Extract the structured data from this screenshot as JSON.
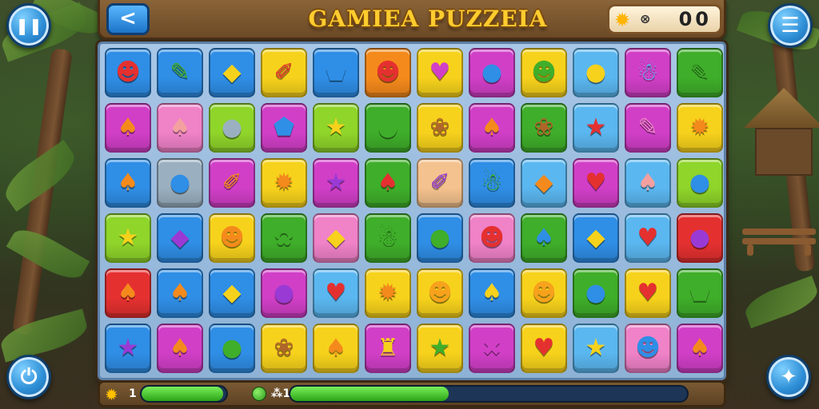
{
  "header": {
    "back_icon": "arrow-left-icon",
    "back_glyph": "<",
    "title": "GAMIEA PUZZEIA",
    "score_icon": "star-icon",
    "score_symbol": "⊗",
    "score_value": "00"
  },
  "side_buttons": {
    "pause_glyph": "❚❚",
    "menu_glyph": "☰",
    "restart_glyph": "⏻",
    "hint_glyph": "✦"
  },
  "footer": {
    "level_star_icon": "star-icon",
    "level_value": "1",
    "progress_1_fraction": 0.96,
    "dot_icon": "green-orb-icon",
    "progress_2_label": "⁂1",
    "progress_2_fraction": 0.4
  },
  "colors": {
    "red": "#e53030",
    "orange": "#f58a1c",
    "yellow": "#f7d21c",
    "green": "#3fae2a",
    "lime": "#8fd52a",
    "blue": "#2f8ee6",
    "lightblue": "#5bb7f0",
    "purple": "#9a3ad4",
    "magenta": "#d13fc7",
    "pink": "#f082c8",
    "peach": "#f4c28e",
    "gray": "#9ab0c0"
  },
  "board": {
    "rows": [
      [
        {
          "bg": "blue",
          "fg": "#e53030",
          "glyph": "☻",
          "name": "red-blob-icon"
        },
        {
          "bg": "blue",
          "fg": "#3fae2a",
          "glyph": "✎",
          "name": "green-bottle-icon"
        },
        {
          "bg": "blue",
          "fg": "#f7d21c",
          "glyph": "◆",
          "name": "yellow-gem-icon"
        },
        {
          "bg": "yellow",
          "fg": "#e53030",
          "glyph": "✐",
          "name": "red-rocket-icon"
        },
        {
          "bg": "blue",
          "fg": "#2f8ee6",
          "glyph": "⬟",
          "name": "blue-shield-icon"
        },
        {
          "bg": "orange",
          "fg": "#e53030",
          "glyph": "☻",
          "name": "red-face-icon"
        },
        {
          "bg": "yellow",
          "fg": "#d13fc7",
          "glyph": "♥",
          "name": "purple-heart-icon"
        },
        {
          "bg": "magenta",
          "fg": "#2f8ee6",
          "glyph": "●",
          "name": "blue-orb-icon"
        },
        {
          "bg": "yellow",
          "fg": "#3fae2a",
          "glyph": "☻",
          "name": "green-face-icon"
        },
        {
          "bg": "lightblue",
          "fg": "#f7d21c",
          "glyph": "●",
          "name": "yellow-drop-icon"
        },
        {
          "bg": "magenta",
          "fg": "#5bb7f0",
          "glyph": "☃",
          "name": "blue-creature-icon"
        },
        {
          "bg": "green",
          "fg": "#3fae2a",
          "glyph": "✎",
          "name": "green-rocket-icon"
        }
      ],
      [
        {
          "bg": "magenta",
          "fg": "#f58a1c",
          "glyph": "♠",
          "name": "orange-carrot-icon"
        },
        {
          "bg": "pink",
          "fg": "#f4a0a0",
          "glyph": "♠",
          "name": "pink-drop-icon"
        },
        {
          "bg": "lime",
          "fg": "#9ab0c0",
          "glyph": "●",
          "name": "gray-blob-icon"
        },
        {
          "bg": "magenta",
          "fg": "#2f8ee6",
          "glyph": "⬟",
          "name": "blue-gem-icon"
        },
        {
          "bg": "lime",
          "fg": "#f7d21c",
          "glyph": "★",
          "name": "yellow-star-icon"
        },
        {
          "bg": "green",
          "fg": "#3fae2a",
          "glyph": "●",
          "name": "green-balloon-icon"
        },
        {
          "bg": "yellow",
          "fg": "#b0652a",
          "glyph": "❀",
          "name": "bread-icon"
        },
        {
          "bg": "magenta",
          "fg": "#f58a1c",
          "glyph": "♠",
          "name": "orange-carrot-icon"
        },
        {
          "bg": "green",
          "fg": "#b0652a",
          "glyph": "❀",
          "name": "bread-loaf-icon"
        },
        {
          "bg": "lightblue",
          "fg": "#e53030",
          "glyph": "★",
          "name": "red-star-icon"
        },
        {
          "bg": "magenta",
          "fg": "#f082c8",
          "glyph": "✎",
          "name": "pink-rocket-icon"
        },
        {
          "bg": "yellow",
          "fg": "#f58a1c",
          "glyph": "✹",
          "name": "orange-sun-icon"
        }
      ],
      [
        {
          "bg": "blue",
          "fg": "#f58a1c",
          "glyph": "♠",
          "name": "orange-leaf-icon"
        },
        {
          "bg": "gray",
          "fg": "#2f8ee6",
          "glyph": "●",
          "name": "blue-balloon-icon"
        },
        {
          "bg": "magenta",
          "fg": "#f58a1c",
          "glyph": "✐",
          "name": "orange-pencil-icon"
        },
        {
          "bg": "yellow",
          "fg": "#f58a1c",
          "glyph": "✹",
          "name": "orange-sun-icon"
        },
        {
          "bg": "magenta",
          "fg": "#9a3ad4",
          "glyph": "★",
          "name": "purple-star-icon"
        },
        {
          "bg": "green",
          "fg": "#e53030",
          "glyph": "♠",
          "name": "red-pepper-icon"
        },
        {
          "bg": "peach",
          "fg": "#9a3ad4",
          "glyph": "✐",
          "name": "purple-rocket-icon"
        },
        {
          "bg": "blue",
          "fg": "#3fae2a",
          "glyph": "☃",
          "name": "green-frog-icon"
        },
        {
          "bg": "lightblue",
          "fg": "#f58a1c",
          "glyph": "◆",
          "name": "orange-gem-icon"
        },
        {
          "bg": "magenta",
          "fg": "#e53030",
          "glyph": "♥",
          "name": "red-heart-icon"
        },
        {
          "bg": "lightblue",
          "fg": "#f4a0a0",
          "glyph": "♠",
          "name": "pink-drop-icon"
        },
        {
          "bg": "lime",
          "fg": "#2f8ee6",
          "glyph": "●",
          "name": "blue-balloon-icon"
        }
      ],
      [
        {
          "bg": "lime",
          "fg": "#f7d21c",
          "glyph": "★",
          "name": "yellow-star-icon"
        },
        {
          "bg": "blue",
          "fg": "#9a3ad4",
          "glyph": "◆",
          "name": "purple-gem-icon"
        },
        {
          "bg": "yellow",
          "fg": "#f58a1c",
          "glyph": "☻",
          "name": "orange-face-icon"
        },
        {
          "bg": "green",
          "fg": "#3fae2a",
          "glyph": "✿",
          "name": "green-clover-icon"
        },
        {
          "bg": "pink",
          "fg": "#f7d21c",
          "glyph": "◆",
          "name": "yellow-candy-icon"
        },
        {
          "bg": "green",
          "fg": "#3fae2a",
          "glyph": "☃",
          "name": "green-frog-icon"
        },
        {
          "bg": "blue",
          "fg": "#3fae2a",
          "glyph": "●",
          "name": "green-balloon-icon"
        },
        {
          "bg": "pink",
          "fg": "#e53030",
          "glyph": "☻",
          "name": "red-face-icon"
        },
        {
          "bg": "green",
          "fg": "#2f8ee6",
          "glyph": "♠",
          "name": "blue-bean-icon"
        },
        {
          "bg": "blue",
          "fg": "#f7d21c",
          "glyph": "◆",
          "name": "yellow-gem-icon"
        },
        {
          "bg": "lightblue",
          "fg": "#e53030",
          "glyph": "♥",
          "name": "red-heart-icon"
        },
        {
          "bg": "red",
          "fg": "#9a3ad4",
          "glyph": "●",
          "name": "purple-egg-icon"
        }
      ],
      [
        {
          "bg": "red",
          "fg": "#f58a1c",
          "glyph": "♠",
          "name": "orange-bottle-icon"
        },
        {
          "bg": "blue",
          "fg": "#f58a1c",
          "glyph": "♠",
          "name": "orange-drop-icon"
        },
        {
          "bg": "blue",
          "fg": "#f7d21c",
          "glyph": "◆",
          "name": "yellow-gem-icon"
        },
        {
          "bg": "magenta",
          "fg": "#9a3ad4",
          "glyph": "●",
          "name": "purple-orb-icon"
        },
        {
          "bg": "lightblue",
          "fg": "#e53030",
          "glyph": "♥",
          "name": "red-heart-icon"
        },
        {
          "bg": "yellow",
          "fg": "#f58a1c",
          "glyph": "✹",
          "name": "orange-creature-icon"
        },
        {
          "bg": "yellow",
          "fg": "#f7a21c",
          "glyph": "☻",
          "name": "orange-face-icon"
        },
        {
          "bg": "blue",
          "fg": "#f7d21c",
          "glyph": "♠",
          "name": "yellow-drop-icon"
        },
        {
          "bg": "yellow",
          "fg": "#f7a21c",
          "glyph": "☻",
          "name": "orange-face-icon"
        },
        {
          "bg": "green",
          "fg": "#2f8ee6",
          "glyph": "●",
          "name": "blue-orb-icon"
        },
        {
          "bg": "yellow",
          "fg": "#e53030",
          "glyph": "♥",
          "name": "red-heart-icon"
        },
        {
          "bg": "green",
          "fg": "#3fae2a",
          "glyph": "⬟",
          "name": "green-shield-icon"
        }
      ],
      [
        {
          "bg": "blue",
          "fg": "#9a3ad4",
          "glyph": "★",
          "name": "purple-star-icon"
        },
        {
          "bg": "magenta",
          "fg": "#f58a1c",
          "glyph": "♠",
          "name": "orange-leaf-icon"
        },
        {
          "bg": "blue",
          "fg": "#3fae2a",
          "glyph": "●",
          "name": "green-balloon-icon"
        },
        {
          "bg": "yellow",
          "fg": "#b0652a",
          "glyph": "❀",
          "name": "bread-icon"
        },
        {
          "bg": "yellow",
          "fg": "#f58a1c",
          "glyph": "♠",
          "name": "orange-carrot-icon"
        },
        {
          "bg": "magenta",
          "fg": "#f7d21c",
          "glyph": "♜",
          "name": "yellow-cup-icon"
        },
        {
          "bg": "yellow",
          "fg": "#3fae2a",
          "glyph": "★",
          "name": "green-star-icon"
        },
        {
          "bg": "magenta",
          "fg": "#d13fc7",
          "glyph": "✖",
          "name": "magenta-x-icon"
        },
        {
          "bg": "yellow",
          "fg": "#e53030",
          "glyph": "♥",
          "name": "red-heart-icon"
        },
        {
          "bg": "lightblue",
          "fg": "#f7d21c",
          "glyph": "★",
          "name": "yellow-star-icon"
        },
        {
          "bg": "pink",
          "fg": "#2f8ee6",
          "glyph": "☻",
          "name": "blue-face-icon"
        },
        {
          "bg": "magenta",
          "fg": "#f58a1c",
          "glyph": "♠",
          "name": "orange-drop-icon"
        }
      ]
    ]
  }
}
